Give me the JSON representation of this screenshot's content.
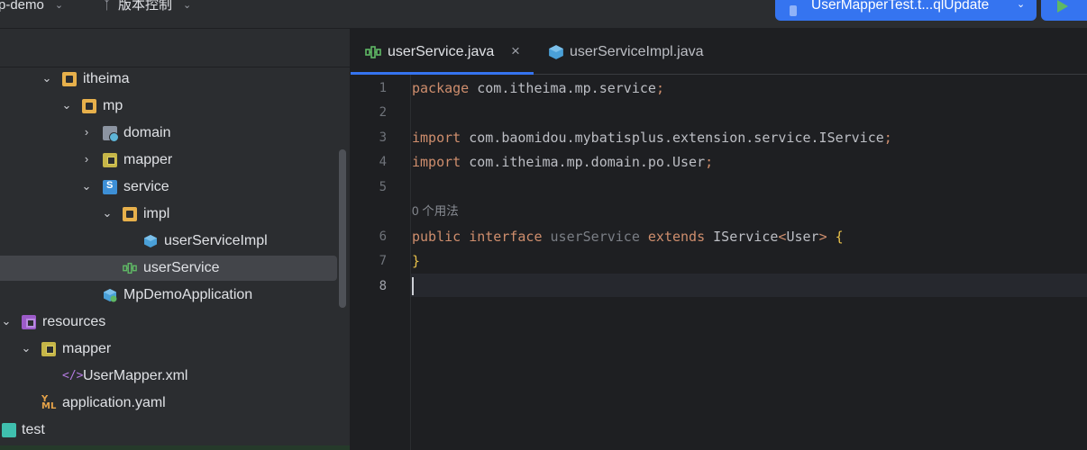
{
  "titlebar": {
    "project_name": "p-demo",
    "vcs_label": "版本控制",
    "run_config": "UserMapperTest.t...qlUpdate"
  },
  "tree": {
    "items": [
      {
        "label": "itheima",
        "name": "tree-item-itheima"
      },
      {
        "label": "mp",
        "name": "tree-item-mp"
      },
      {
        "label": "domain",
        "name": "tree-item-domain"
      },
      {
        "label": "mapper",
        "name": "tree-item-mapper"
      },
      {
        "label": "service",
        "name": "tree-item-service"
      },
      {
        "label": "impl",
        "name": "tree-item-impl"
      },
      {
        "label": "userServiceImpl",
        "name": "tree-item-userserviceimpl"
      },
      {
        "label": "userService",
        "name": "tree-item-userservice"
      },
      {
        "label": "MpDemoApplication",
        "name": "tree-item-mpdemoapplication"
      },
      {
        "label": "resources",
        "name": "tree-item-resources"
      },
      {
        "label": "mapper",
        "name": "tree-item-resources-mapper"
      },
      {
        "label": "UserMapper.xml",
        "name": "tree-item-usermapper-xml"
      },
      {
        "label": "application.yaml",
        "name": "tree-item-application-yaml"
      },
      {
        "label": "test",
        "name": "tree-item-test"
      }
    ]
  },
  "tabs": [
    {
      "label": "userService.java",
      "active": true
    },
    {
      "label": "userServiceImpl.java",
      "active": false
    }
  ],
  "editor": {
    "line_numbers": [
      "1",
      "2",
      "3",
      "4",
      "5",
      "6",
      "7",
      "8"
    ],
    "current_line": 8,
    "usage_hint": "0 个用法",
    "code": {
      "l1_kw": "package",
      "l1_rest": " com.itheima.mp.service",
      "l1_semi": ";",
      "l3_kw": "import",
      "l3_rest": " com.baomidou.mybatisplus.extension.service.IService",
      "l3_semi": ";",
      "l4_kw": "import",
      "l4_rest": " com.itheima.mp.domain.po.User",
      "l4_semi": ";",
      "l6_kw1": "public",
      "l6_kw2": "interface",
      "l6_name": "userService",
      "l6_kw3": "extends",
      "l6_type": "IService",
      "l6_lt": "<",
      "l6_generic": "User",
      "l6_gt": ">",
      "l6_brace": " {",
      "l7_brace": "}"
    }
  },
  "colors": {
    "keyword": "#cf8e6d",
    "unused_name": "#7a7e85",
    "accent": "#3574f0",
    "background": "#1e1f22",
    "panel": "#2b2d30"
  }
}
